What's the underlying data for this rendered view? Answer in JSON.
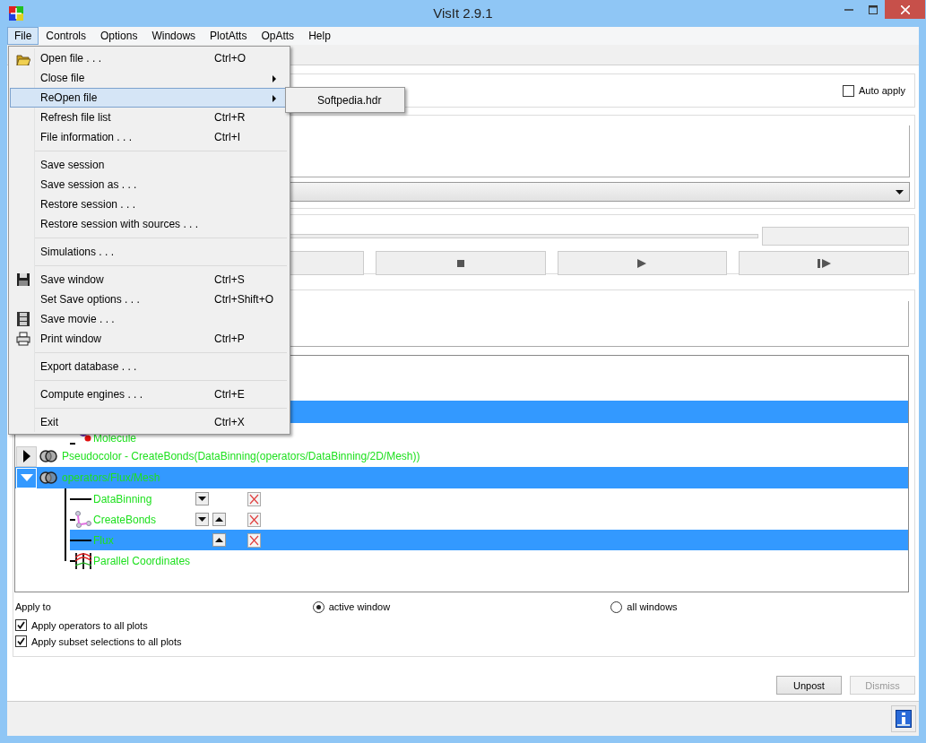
{
  "window": {
    "title": "VisIt 2.9.1"
  },
  "menu_bar": [
    {
      "label": "File",
      "selected": true
    },
    {
      "label": "Controls",
      "selected": false
    },
    {
      "label": "Options",
      "selected": false
    },
    {
      "label": "Windows",
      "selected": false
    },
    {
      "label": "PlotAtts",
      "selected": false
    },
    {
      "label": "OpAtts",
      "selected": false
    },
    {
      "label": "Help",
      "selected": false
    }
  ],
  "file_menu": {
    "groups": [
      [
        {
          "label": "Open file . . .",
          "shortcut": "Ctrl+O",
          "kind": "folder",
          "submenu": false,
          "selected": false
        },
        {
          "label": "Close file",
          "kind": "plain",
          "submenu": true,
          "selected": false
        },
        {
          "label": "ReOpen file",
          "kind": "plain",
          "submenu": true,
          "selected": true
        },
        {
          "label": "Refresh file list",
          "shortcut": "Ctrl+R",
          "kind": "plain",
          "submenu": false,
          "selected": false
        },
        {
          "label": "File information . . .",
          "shortcut": "Ctrl+I",
          "kind": "plain",
          "submenu": false,
          "selected": false
        }
      ],
      [
        {
          "label": "Save session",
          "kind": "plain",
          "submenu": false,
          "selected": false
        },
        {
          "label": "Save session as . . .",
          "kind": "plain",
          "submenu": false,
          "selected": false
        },
        {
          "label": "Restore session . . .",
          "kind": "plain",
          "submenu": false,
          "selected": false
        },
        {
          "label": "Restore session with sources . . .",
          "kind": "plain",
          "submenu": false,
          "selected": false
        }
      ],
      [
        {
          "label": "Simulations . . .",
          "kind": "plain",
          "submenu": false,
          "selected": false
        }
      ],
      [
        {
          "label": "Save window",
          "shortcut": "Ctrl+S",
          "kind": "floppy",
          "submenu": false,
          "selected": false
        },
        {
          "label": "Set Save options . . .",
          "shortcut": "Ctrl+Shift+O",
          "kind": "plain",
          "submenu": false,
          "selected": false
        },
        {
          "label": "Save movie . . .",
          "kind": "film",
          "submenu": false,
          "selected": false
        },
        {
          "label": "Print window",
          "shortcut": "Ctrl+P",
          "kind": "printer",
          "submenu": false,
          "selected": false
        }
      ],
      [
        {
          "label": "Export database . . .",
          "kind": "plain",
          "submenu": false,
          "selected": false
        }
      ],
      [
        {
          "label": "Compute engines . . .",
          "shortcut": "Ctrl+E",
          "kind": "plain",
          "submenu": false,
          "selected": false
        }
      ],
      [
        {
          "label": "Exit",
          "shortcut": "Ctrl+X",
          "kind": "plain",
          "submenu": false,
          "selected": false
        }
      ]
    ]
  },
  "reopen_submenu": {
    "items": [
      {
        "label": "Softpedia.hdr"
      }
    ]
  },
  "auto_apply": {
    "label": "Auto apply",
    "checked": false
  },
  "animation_buttons": [
    {
      "kind": "blank"
    },
    {
      "kind": "stop"
    },
    {
      "kind": "play"
    },
    {
      "kind": "step"
    }
  ],
  "plot_list": {
    "plots": [
      {
        "selected": true,
        "expanded": true,
        "operators": [
          {
            "label": "Molecule",
            "kind": "molecule",
            "selected": false
          }
        ]
      },
      {
        "label": "Pseudocolor - CreateBonds(DataBinning(operators/DataBinning/2D/Mesh))",
        "selected": false,
        "expanded": false
      },
      {
        "label": "operators/Flux/Mesh",
        "selected": true,
        "expanded": true,
        "operators": [
          {
            "label": "DataBinning",
            "kind": "line",
            "selected": false,
            "move_down": true,
            "move_up": false,
            "removable": true
          },
          {
            "label": "CreateBonds",
            "kind": "bonds",
            "selected": false,
            "move_down": true,
            "move_up": true,
            "removable": true
          },
          {
            "label": "Flux",
            "kind": "line",
            "selected": true,
            "move_down": false,
            "move_up": true,
            "removable": true
          },
          {
            "label": "Parallel Coordinates",
            "kind": "parallel",
            "selected": false,
            "move_down": false,
            "move_up": false,
            "removable": false
          }
        ]
      }
    ]
  },
  "apply_to": {
    "label": "Apply to",
    "options": [
      {
        "label": "active window",
        "selected": true
      },
      {
        "label": "all windows",
        "selected": false
      }
    ]
  },
  "options": [
    {
      "label": "Apply operators to all plots",
      "checked": true
    },
    {
      "label": "Apply subset selections to all plots",
      "checked": true
    }
  ],
  "buttons": [
    {
      "label": "Unpost",
      "disabled": false
    },
    {
      "label": "Dismiss",
      "disabled": true
    }
  ]
}
